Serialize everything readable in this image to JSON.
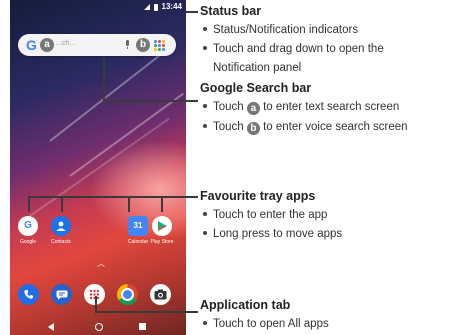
{
  "phone": {
    "status_bar": {
      "time": "13:44"
    },
    "search_bar": {
      "logo": "G",
      "badge_a": "a",
      "badge_b": "b",
      "hint": "...ch...",
      "mic_icon": "mic-icon",
      "apps_icon": "nine-dot-grid-icon"
    },
    "favourite_apps": [
      {
        "label": "Google",
        "icon": "google-icon",
        "color": "#ffffff",
        "glyph": "G"
      },
      {
        "label": "Contacts",
        "icon": "contacts-icon",
        "color": "#1a73e8",
        "glyph": ""
      },
      {
        "label": "Calendar",
        "icon": "calendar-icon",
        "color": "#4285f4",
        "glyph": "31"
      },
      {
        "label": "Play Store",
        "icon": "play-store-icon",
        "color": "#ffffff",
        "glyph": ""
      }
    ],
    "dock": [
      {
        "icon": "phone-icon",
        "color": "#1e6ee8",
        "glyph": "✆"
      },
      {
        "icon": "messages-icon",
        "color": "#2563c9",
        "glyph": ""
      },
      {
        "icon": "all-apps-icon",
        "color": "#ffffff",
        "glyph": ""
      },
      {
        "icon": "chrome-icon",
        "color": "#db4437",
        "glyph": ""
      },
      {
        "icon": "camera-icon",
        "color": "#ffffff",
        "glyph": ""
      }
    ]
  },
  "callouts": {
    "status_bar": {
      "title": "Status bar",
      "bullets": [
        "Status/Notification indicators",
        "Touch and drag down to open the",
        "Notification panel"
      ]
    },
    "search_bar": {
      "title": "Google Search bar",
      "b1_pre": "Touch",
      "b1_badge": "a",
      "b1_post": "to enter text search screen",
      "b2_pre": "Touch",
      "b2_badge": "b",
      "b2_post": "to enter voice search screen"
    },
    "favourite_tray": {
      "title": "Favourite tray apps",
      "bullets": [
        "Touch to enter the app",
        "Long press to move apps"
      ]
    },
    "application_tab": {
      "title": "Application tab",
      "bullets": [
        "Touch to open All apps"
      ]
    }
  }
}
